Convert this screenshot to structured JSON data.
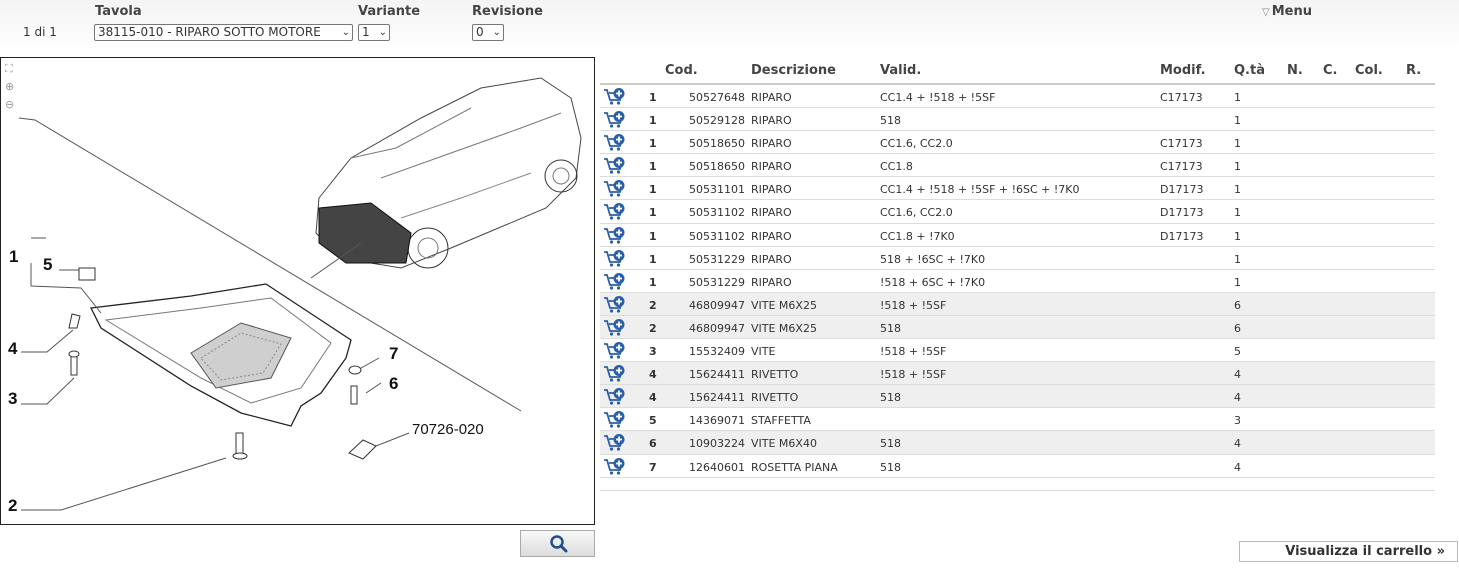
{
  "toolbar": {
    "tavola_label": "Tavola",
    "variante_label": "Variante",
    "revisione_label": "Revisione",
    "counter": "1 di 1",
    "tavola_value": "38115-010 - RIPARO SOTTO MOTORE",
    "variante_value": "1",
    "revisione_value": "0",
    "menu_label": "Menu"
  },
  "drawing": {
    "callouts": [
      "1",
      "5",
      "4",
      "3",
      "2",
      "7",
      "6"
    ],
    "ref_label": "70726-020"
  },
  "table": {
    "headers": {
      "cod": "Cod.",
      "descrizione": "Descrizione",
      "valid": "Valid.",
      "modif": "Modif.",
      "qta": "Q.tà",
      "n": "N.",
      "c": "C.",
      "col": "Col.",
      "r": "R."
    },
    "rows": [
      {
        "pos": "1",
        "code": "50527648",
        "desc": "RIPARO",
        "valid": "CC1.4 + !518 + !5SF",
        "modif": "C17173",
        "qty": "1"
      },
      {
        "pos": "1",
        "code": "50529128",
        "desc": "RIPARO",
        "valid": "518",
        "modif": "",
        "qty": "1"
      },
      {
        "pos": "1",
        "code": "50518650",
        "desc": "RIPARO",
        "valid": "CC1.6, CC2.0",
        "modif": "C17173",
        "qty": "1"
      },
      {
        "pos": "1",
        "code": "50518650",
        "desc": "RIPARO",
        "valid": "CC1.8",
        "modif": "C17173",
        "qty": "1"
      },
      {
        "pos": "1",
        "code": "50531101",
        "desc": "RIPARO",
        "valid": "CC1.4 + !518 + !5SF + !6SC + !7K0",
        "modif": "D17173",
        "qty": "1"
      },
      {
        "pos": "1",
        "code": "50531102",
        "desc": "RIPARO",
        "valid": "CC1.6, CC2.0",
        "modif": "D17173",
        "qty": "1"
      },
      {
        "pos": "1",
        "code": "50531102",
        "desc": "RIPARO",
        "valid": "CC1.8 + !7K0",
        "modif": "D17173",
        "qty": "1"
      },
      {
        "pos": "1",
        "code": "50531229",
        "desc": "RIPARO",
        "valid": "518 + !6SC + !7K0",
        "modif": "",
        "qty": "1"
      },
      {
        "pos": "1",
        "code": "50531229",
        "desc": "RIPARO",
        "valid": "!518 + 6SC + !7K0",
        "modif": "",
        "qty": "1"
      },
      {
        "pos": "2",
        "code": "46809947",
        "desc": "VITE M6X25",
        "valid": "!518 + !5SF",
        "modif": "",
        "qty": "6"
      },
      {
        "pos": "2",
        "code": "46809947",
        "desc": "VITE M6X25",
        "valid": "518",
        "modif": "",
        "qty": "6"
      },
      {
        "pos": "3",
        "code": "15532409",
        "desc": "VITE",
        "valid": "!518 + !5SF",
        "modif": "",
        "qty": "5"
      },
      {
        "pos": "4",
        "code": "15624411",
        "desc": "RIVETTO",
        "valid": "!518 + !5SF",
        "modif": "",
        "qty": "4"
      },
      {
        "pos": "4",
        "code": "15624411",
        "desc": "RIVETTO",
        "valid": "518",
        "modif": "",
        "qty": "4"
      },
      {
        "pos": "5",
        "code": "14369071",
        "desc": "STAFFETTA",
        "valid": "",
        "modif": "",
        "qty": "3"
      },
      {
        "pos": "6",
        "code": "10903224",
        "desc": "VITE M6X40",
        "valid": "518",
        "modif": "",
        "qty": "4"
      },
      {
        "pos": "7",
        "code": "12640601",
        "desc": "ROSETTA PIANA",
        "valid": "518",
        "modif": "",
        "qty": "4"
      }
    ]
  },
  "footer": {
    "cart_link": "Visualizza il carrello »"
  },
  "icons": {
    "cart": "cart-add-icon",
    "zoom": "magnifier-icon"
  },
  "colors": {
    "cart_blue": "#2a5fa8",
    "alt_row": "#efefef"
  }
}
